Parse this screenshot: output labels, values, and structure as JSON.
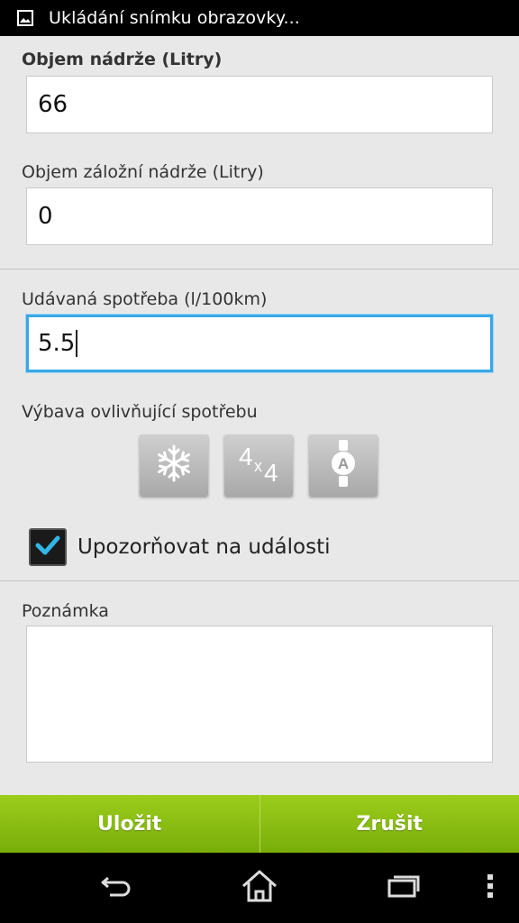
{
  "status_bar": {
    "notification_text": "Ukládání snímku obrazovky...",
    "icon": "image-icon"
  },
  "form": {
    "tank_label": "Objem nádrže (Litry)",
    "tank_value": "66",
    "reserve_label": "Objem záložní nádrže (Litry)",
    "reserve_value": "0",
    "consumption_label": "Udávaná spotřeba (l/100km)",
    "consumption_value": "5.5",
    "equipment_label": "Výbava ovlivňující spotřebu",
    "equipment_toggles": [
      {
        "icon": "snowflake-icon"
      },
      {
        "icon": "four-by-four-icon",
        "text_main": "4",
        "text_sub": "x",
        "text_end": "4"
      },
      {
        "icon": "automatic-gearbox-icon",
        "text": "A"
      }
    ],
    "notify_label": "Upozorňovat na události",
    "notify_checked": true,
    "note_label": "Poznámka",
    "note_value": ""
  },
  "actions": {
    "save_label": "Uložit",
    "cancel_label": "Zrušit"
  },
  "nav_bar": {
    "back": "back-icon",
    "home": "home-icon",
    "recents": "recents-icon",
    "menu": "overflow-menu-icon"
  },
  "colors": {
    "accent_green": "#8bbf12",
    "focus_blue": "#3aa7e6",
    "check_blue": "#33b5e5"
  }
}
